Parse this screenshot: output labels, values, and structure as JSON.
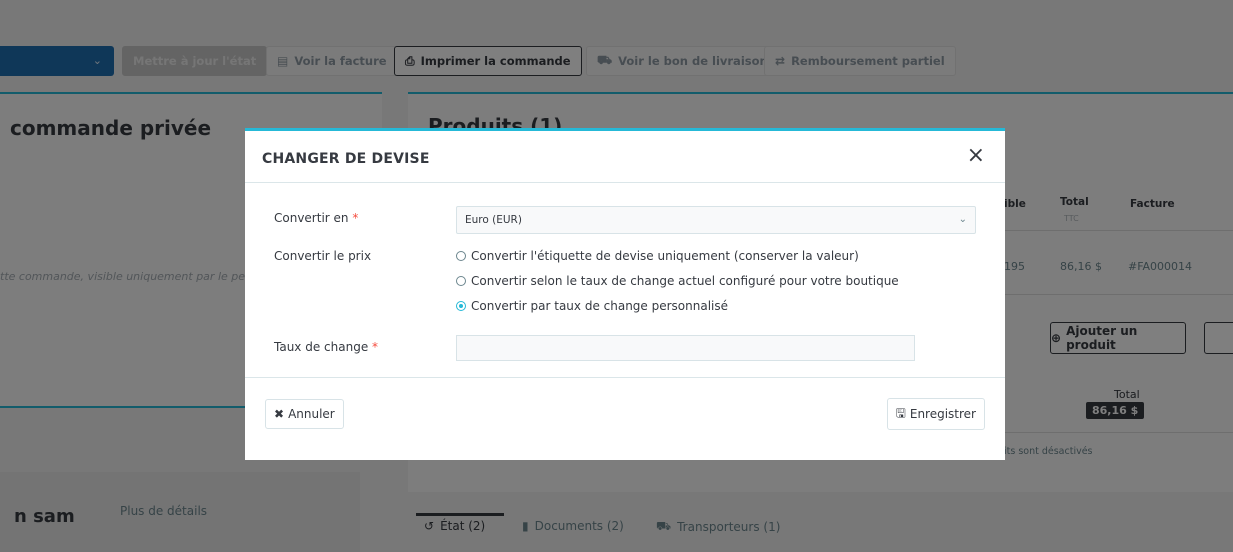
{
  "toolbar": {
    "update_status_label": "Mettre à jour l'état",
    "view_invoice_label": "Voir la facture",
    "print_order_label": "Imprimer la commande",
    "view_delivery_slip_label": "Voir le bon de livraison",
    "partial_refund_label": "Remboursement partiel"
  },
  "left_panel": {
    "title": "commande privée",
    "hint": "tte commande, visible uniquement par le pe",
    "customer_name": "n sam",
    "more_details_label": "Plus de détails"
  },
  "products": {
    "title": "Produits (1)",
    "columns": {
      "available": "ible",
      "total": "Total",
      "total_sub": "TTC",
      "invoice": "Facture"
    },
    "row": {
      "available": "195",
      "total": "86,16 $",
      "invoice": "#FA000014"
    },
    "add_product_label": "Ajouter un produit",
    "total_label": "Total",
    "total_value": "86,16 $",
    "disabled_note": "its sont désactivés"
  },
  "tabs": [
    {
      "label": "État (2)"
    },
    {
      "label": "Documents (2)"
    },
    {
      "label": "Transporteurs (1)"
    }
  ],
  "modal": {
    "title": "CHANGER DE DEVISE",
    "convert_to_label": "Convertir en",
    "currency_selected": "Euro (EUR)",
    "convert_price_label": "Convertir le prix",
    "options": [
      {
        "label": "Convertir l'étiquette de devise uniquement (conserver la valeur)",
        "checked": false
      },
      {
        "label": "Convertir selon le taux de change actuel configuré pour votre boutique",
        "checked": false
      },
      {
        "label": "Convertir par taux de change personnalisé",
        "checked": true
      }
    ],
    "exchange_rate_label": "Taux de change",
    "exchange_rate_value": "",
    "cancel_label": "Annuler",
    "save_label": "Enregistrer"
  },
  "colors": {
    "accent": "#25b9d7",
    "primary_dark": "#363a41",
    "required": "#f54c3e"
  }
}
